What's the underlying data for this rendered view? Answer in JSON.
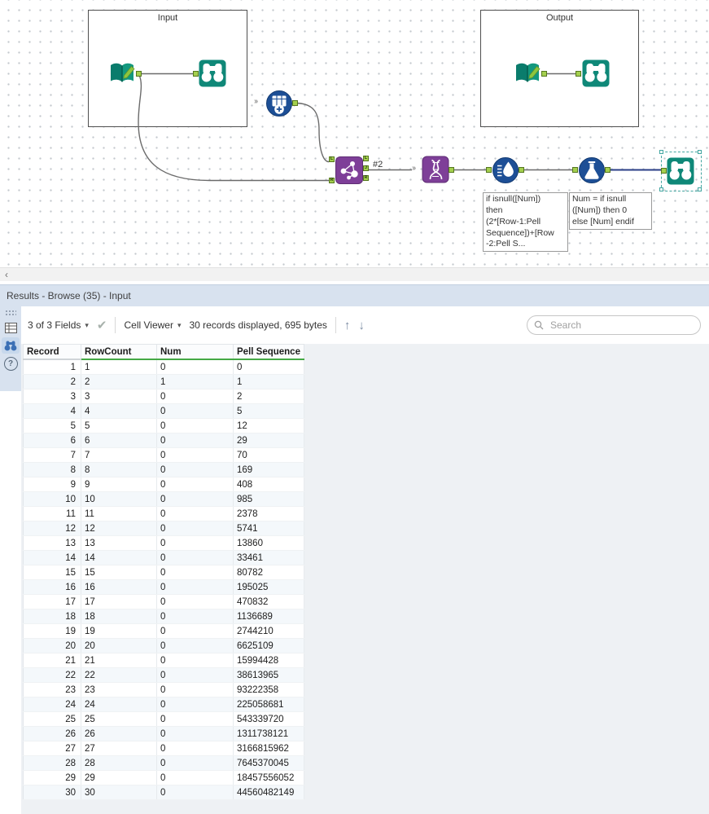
{
  "icons": {
    "caret_down": "▾",
    "check": "✔",
    "arrow_up": "↑",
    "arrow_down": "↓",
    "scroll_left": "‹",
    "incoming": "››",
    "help": "?"
  },
  "canvas": {
    "containers": [
      {
        "label": "Input"
      },
      {
        "label": "Output"
      }
    ],
    "join_output_label": "#2",
    "join": {
      "left_anchor_labels": [
        "L",
        "R"
      ],
      "right_anchor_labels": [
        "L",
        "J",
        "R"
      ]
    },
    "annotations": [
      {
        "text": "if isnull([Num])\nthen\n(2*[Row-1:Pell\nSequence])+[Row\n-2:Pell S..."
      },
      {
        "text": "Num = if isnull\n([Num]) then 0\nelse [Num] endif"
      }
    ]
  },
  "results": {
    "title": "Results - Browse (35) - Input",
    "toolbar": {
      "fields_label": "3 of 3 Fields",
      "cell_viewer_label": "Cell Viewer",
      "records_label": "30 records displayed, 695 bytes",
      "search_placeholder": "Search"
    },
    "grid": {
      "columns": [
        "Record",
        "RowCount",
        "Num",
        "Pell Sequence"
      ],
      "rows": [
        [
          "1",
          "1",
          "0",
          "0"
        ],
        [
          "2",
          "2",
          "1",
          "1"
        ],
        [
          "3",
          "3",
          "0",
          "2"
        ],
        [
          "4",
          "4",
          "0",
          "5"
        ],
        [
          "5",
          "5",
          "0",
          "12"
        ],
        [
          "6",
          "6",
          "0",
          "29"
        ],
        [
          "7",
          "7",
          "0",
          "70"
        ],
        [
          "8",
          "8",
          "0",
          "169"
        ],
        [
          "9",
          "9",
          "0",
          "408"
        ],
        [
          "10",
          "10",
          "0",
          "985"
        ],
        [
          "11",
          "11",
          "0",
          "2378"
        ],
        [
          "12",
          "12",
          "0",
          "5741"
        ],
        [
          "13",
          "13",
          "0",
          "13860"
        ],
        [
          "14",
          "14",
          "0",
          "33461"
        ],
        [
          "15",
          "15",
          "0",
          "80782"
        ],
        [
          "16",
          "16",
          "0",
          "195025"
        ],
        [
          "17",
          "17",
          "0",
          "470832"
        ],
        [
          "18",
          "18",
          "0",
          "1136689"
        ],
        [
          "19",
          "19",
          "0",
          "2744210"
        ],
        [
          "20",
          "20",
          "0",
          "6625109"
        ],
        [
          "21",
          "21",
          "0",
          "15994428"
        ],
        [
          "22",
          "22",
          "0",
          "38613965"
        ],
        [
          "23",
          "23",
          "0",
          "93222358"
        ],
        [
          "24",
          "24",
          "0",
          "225058681"
        ],
        [
          "25",
          "25",
          "0",
          "543339720"
        ],
        [
          "26",
          "26",
          "0",
          "1311738121"
        ],
        [
          "27",
          "27",
          "0",
          "3166815962"
        ],
        [
          "28",
          "28",
          "0",
          "7645370045"
        ],
        [
          "29",
          "29",
          "0",
          "18457556052"
        ],
        [
          "30",
          "30",
          "0",
          "44560482149"
        ]
      ]
    }
  }
}
